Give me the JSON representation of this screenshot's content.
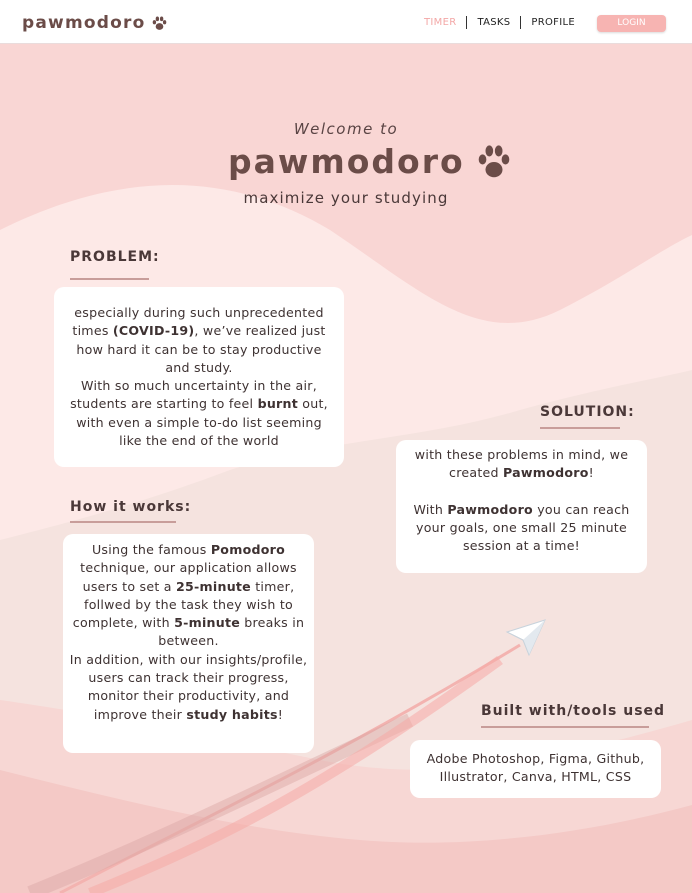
{
  "nav": {
    "brand": "pawmodoro",
    "links": [
      "TIMER",
      "TASKS",
      "PROFILE"
    ],
    "login": "LOGIN"
  },
  "hero": {
    "welcome": "Welcome to",
    "title": "pawmodoro",
    "tagline": "maximize your studying"
  },
  "problem": {
    "heading": "PROBLEM:",
    "p1_a": "especially during such unprecedented times ",
    "p1_bold": "(COVID-19)",
    "p1_b": ", we’ve realized just how hard it can be to stay productive and study.",
    "p2_a": "With so much uncertainty in the air, students are starting to feel ",
    "p2_bold": "burnt",
    "p2_b": " out, with even a simple to-do list seeming like the end of the world"
  },
  "solution": {
    "heading": "SOLUTION:",
    "p1_a": "with these problems in mind, we created ",
    "p1_bold": "Pawmodoro",
    "p1_b": "!",
    "p2_a": "With ",
    "p2_bold": "Pawmodoro",
    "p2_b": " you can reach your goals, one small 25 minute session at a time!"
  },
  "how": {
    "heading": "How it works:",
    "p1_a": "Using the famous ",
    "p1_bold1": "Pomodoro",
    "p1_b": " technique, our application allows users to set a ",
    "p1_bold2": "25-minute",
    "p1_c": " timer, follwed by the task they wish to complete, with ",
    "p1_bold3": "5-minute",
    "p1_d": " breaks in between.",
    "p2_a": "In addition, with our insights/profile, users can track their progress, monitor their productivity, and improve their ",
    "p2_bold": "study habits",
    "p2_b": "!"
  },
  "tools": {
    "heading": "Built with/tools used",
    "text": "Adobe Photoshop, Figma, Github, Illustrator, Canva, HTML, CSS"
  },
  "colors": {
    "accent": "#f7b4b2",
    "brand": "#6b4c48",
    "active_link": "#f3a7a6"
  },
  "icons": [
    "paw-icon",
    "paper-plane-icon"
  ]
}
